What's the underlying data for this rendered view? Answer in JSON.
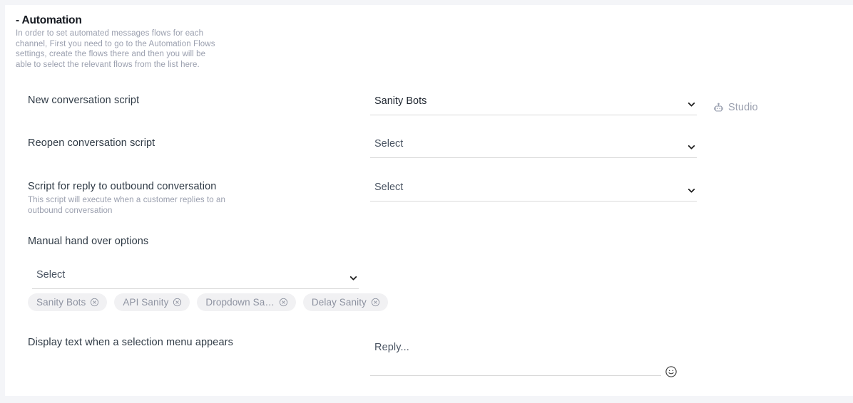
{
  "section": {
    "title": "- Automation",
    "description": "In order to set automated messages flows for each channel, First you need to go to the Automation Flows settings, create the flows there and then you will be able to select the relevant flows from the list here."
  },
  "fields": {
    "new_conversation": {
      "label": "New conversation script",
      "value": "Sanity Bots",
      "options": [
        "Sanity Bots"
      ],
      "chevron_icon": "chevron-down-icon"
    },
    "reopen_conversation": {
      "label": "Reopen conversation script",
      "value": "Select",
      "options": [
        "Select"
      ],
      "chevron_icon": "chevron-down-icon"
    },
    "outbound_reply": {
      "label": "Script for reply to outbound conversation",
      "sublabel": "This script will execute when a customer replies to an outbound conversation",
      "value": "Select",
      "options": [
        "Select"
      ],
      "chevron_icon": "chevron-down-icon"
    },
    "manual_hand_over": {
      "label": "Manual hand over options",
      "value": "Select",
      "options": [
        "Select"
      ],
      "chevron_icon": "chevron-down-icon",
      "chips": [
        {
          "label": "Sanity Bots",
          "remove_icon": "close-circle-icon"
        },
        {
          "label": "API Sanity",
          "remove_icon": "close-circle-icon"
        },
        {
          "label": "Dropdown Sa…",
          "remove_icon": "close-circle-icon"
        },
        {
          "label": "Delay Sanity",
          "remove_icon": "close-circle-icon"
        }
      ]
    },
    "selection_menu_text": {
      "label": "Display text when a selection menu appears",
      "placeholder": "Reply...",
      "value": "",
      "emoji_icon": "smiley-icon"
    }
  },
  "studio_link": {
    "label": "Studio",
    "icon": "robot-icon"
  },
  "colors": {
    "page_background": "#f4f5f8",
    "card_background": "#ffffff",
    "label_text": "#2f3a45",
    "muted_text": "#9a9fae",
    "underline": "#d9d9d9",
    "chip_background": "#f1f1f3"
  }
}
